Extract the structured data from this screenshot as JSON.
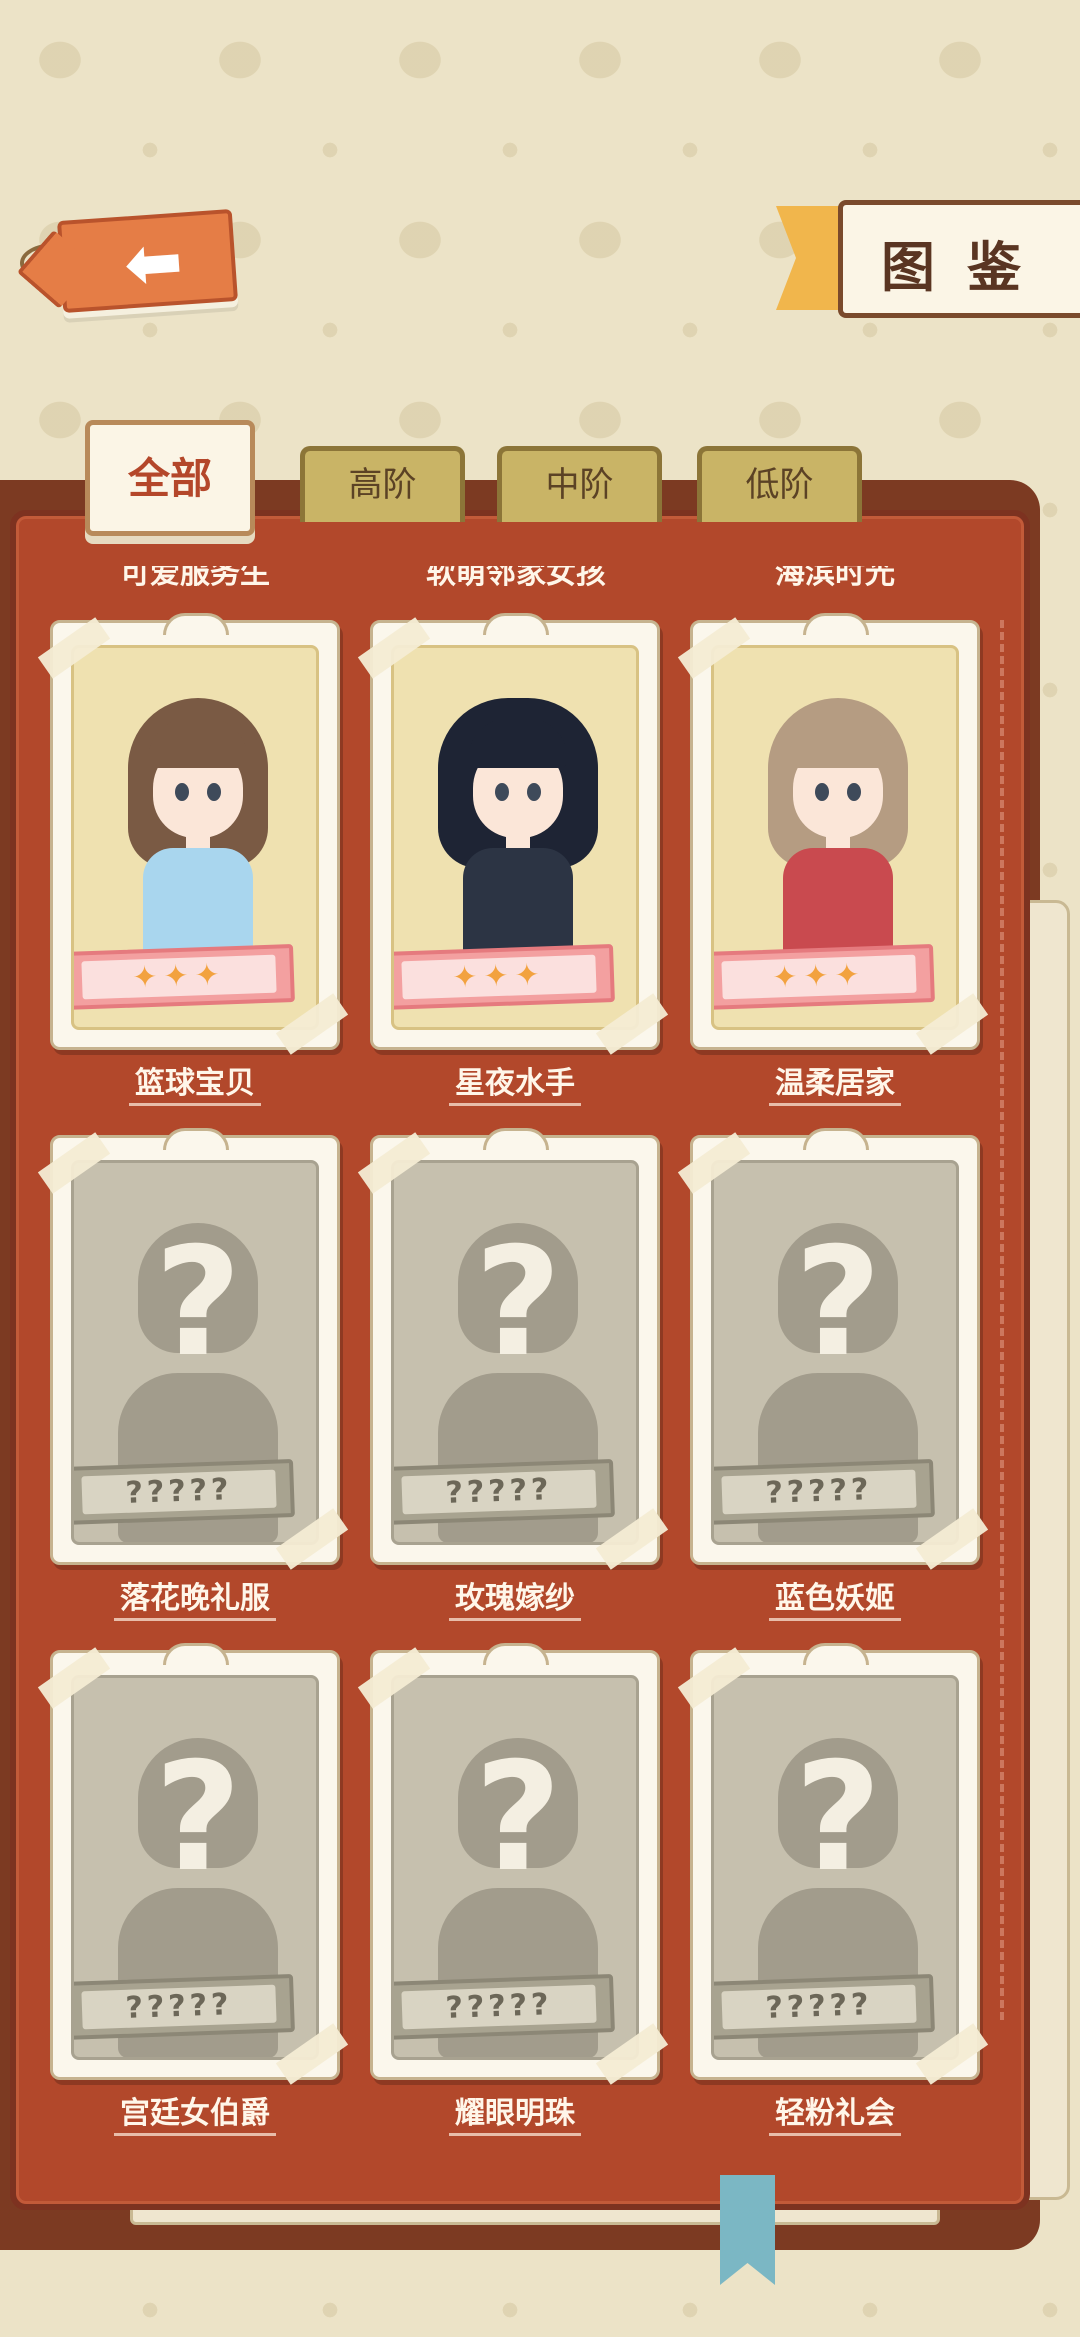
{
  "header": {
    "back_icon": "arrow-left-icon",
    "title": "图鉴"
  },
  "tabs": [
    {
      "label": "全部",
      "active": true
    },
    {
      "label": "高阶",
      "active": false
    },
    {
      "label": "中阶",
      "active": false
    },
    {
      "label": "低阶",
      "active": false
    }
  ],
  "partial_row_labels": [
    "可爱服务生",
    "软萌邻家女孩",
    "海滨时光"
  ],
  "cards": [
    {
      "name": "篮球宝贝",
      "locked": false,
      "stars": "✦✦✦",
      "hair": "#7a5a44",
      "outfit": "#a9d6ee"
    },
    {
      "name": "星夜水手",
      "locked": false,
      "stars": "✦✦✦",
      "hair": "#1e2434",
      "outfit": "#2c3444"
    },
    {
      "name": "温柔居家",
      "locked": false,
      "stars": "✦✦✦",
      "hair": "#b59c82",
      "outfit": "#c94a4f"
    },
    {
      "name": "落花晚礼服",
      "locked": true,
      "mystery": "?????",
      "question": "?"
    },
    {
      "name": "玫瑰嫁纱",
      "locked": true,
      "mystery": "?????",
      "question": "?"
    },
    {
      "name": "蓝色妖姬",
      "locked": true,
      "mystery": "?????",
      "question": "?"
    },
    {
      "name": "宫廷女伯爵",
      "locked": true,
      "mystery": "?????",
      "question": "?"
    },
    {
      "name": "耀眼明珠",
      "locked": true,
      "mystery": "?????",
      "question": "?"
    },
    {
      "name": "轻粉礼会",
      "locked": true,
      "mystery": "?????",
      "question": "?"
    }
  ],
  "colors": {
    "accent": "#b2482b",
    "tag_orange": "#e57d46",
    "active_tab_text": "#b4472a"
  }
}
